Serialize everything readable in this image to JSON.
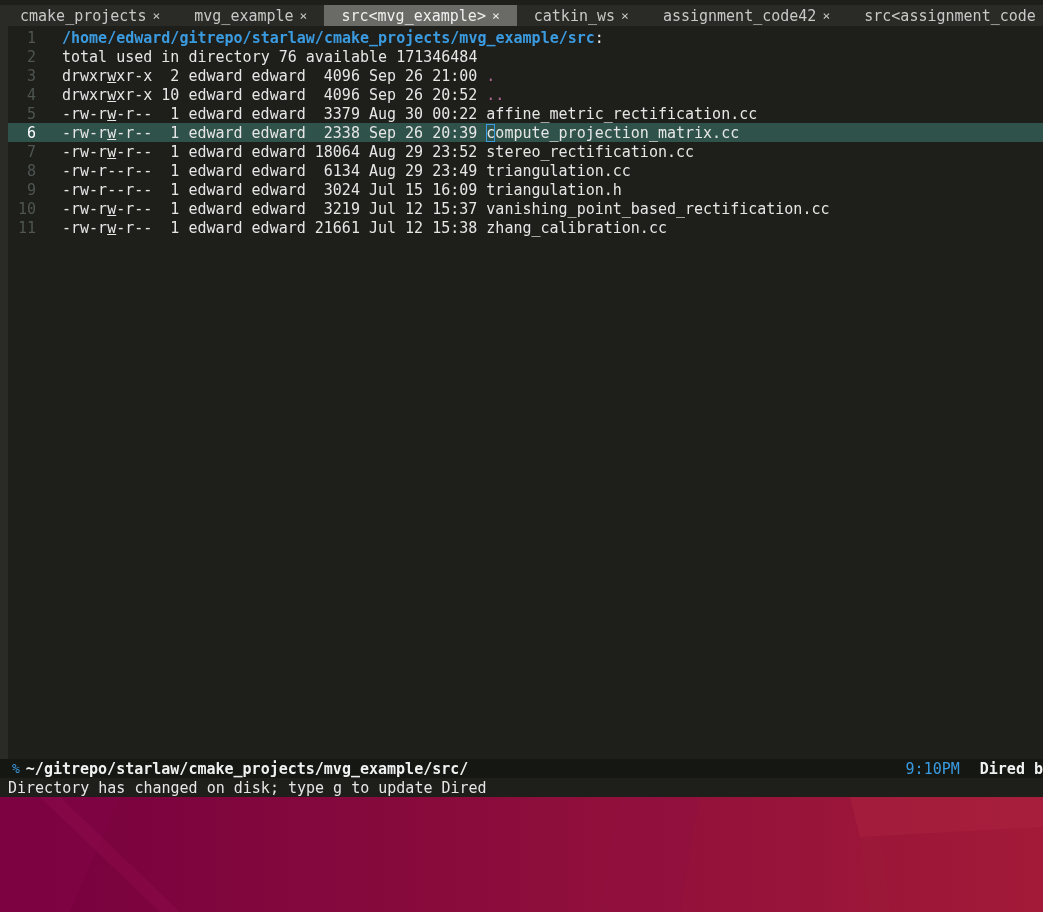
{
  "tabs": [
    {
      "label": "cmake_projects",
      "close": "×",
      "selected": false
    },
    {
      "label": "mvg_example",
      "close": "×",
      "selected": false
    },
    {
      "label": "src<mvg_example>",
      "close": "×",
      "selected": true
    },
    {
      "label": "catkin_ws",
      "close": "×",
      "selected": false
    },
    {
      "label": "assignment_code42",
      "close": "×",
      "selected": false
    },
    {
      "label": "src<assignment_code",
      "selected": false
    }
  ],
  "header": {
    "line": "1",
    "path": "/home/edward/gitrepo/starlaw/cmake_projects/mvg_example/src",
    "suffix": ":"
  },
  "summary": {
    "line": "2",
    "text": "total used in directory 76 available 171346484"
  },
  "rows": [
    {
      "line": "3",
      "perms": "drwxrwxr-x",
      "write_flag": true,
      "links": "2",
      "owner": "edward",
      "group": "edward",
      "size": "4096",
      "date": "Sep 26",
      "time": "21:00",
      "name": ".",
      "kind": "dir",
      "current": false
    },
    {
      "line": "4",
      "perms": "drwxrwxr-x",
      "write_flag": true,
      "links": "10",
      "owner": "edward",
      "group": "edward",
      "size": "4096",
      "date": "Sep 26",
      "time": "20:52",
      "name": "..",
      "kind": "dir",
      "current": false
    },
    {
      "line": "5",
      "perms": "-rw-rw-r--",
      "write_flag": true,
      "links": "1",
      "owner": "edward",
      "group": "edward",
      "size": "3379",
      "date": "Aug 30",
      "time": "00:22",
      "name": "affine_metric_rectification.cc",
      "kind": "file",
      "current": false
    },
    {
      "line": "6",
      "perms": "-rw-rw-r--",
      "write_flag": true,
      "links": "1",
      "owner": "edward",
      "group": "edward",
      "size": "2338",
      "date": "Sep 26",
      "time": "20:39",
      "name": "compute_projection_matrix.cc",
      "kind": "file",
      "current": true
    },
    {
      "line": "7",
      "perms": "-rw-rw-r--",
      "write_flag": true,
      "links": "1",
      "owner": "edward",
      "group": "edward",
      "size": "18064",
      "date": "Aug 29",
      "time": "23:52",
      "name": "stereo_rectification.cc",
      "kind": "file",
      "current": false
    },
    {
      "line": "8",
      "perms": "-rw-r--r--",
      "write_flag": false,
      "links": "1",
      "owner": "edward",
      "group": "edward",
      "size": "6134",
      "date": "Aug 29",
      "time": "23:49",
      "name": "triangulation.cc",
      "kind": "file",
      "current": false
    },
    {
      "line": "9",
      "perms": "-rw-r--r--",
      "write_flag": false,
      "links": "1",
      "owner": "edward",
      "group": "edward",
      "size": "3024",
      "date": "Jul 15",
      "time": "16:09",
      "name": "triangulation.h",
      "kind": "file",
      "current": false
    },
    {
      "line": "10",
      "perms": "-rw-rw-r--",
      "write_flag": true,
      "links": "1",
      "owner": "edward",
      "group": "edward",
      "size": "3219",
      "date": "Jul 12",
      "time": "15:37",
      "name": "vanishing_point_based_rectification.cc",
      "kind": "file",
      "current": false
    },
    {
      "line": "11",
      "perms": "-rw-rw-r--",
      "write_flag": true,
      "links": "1",
      "owner": "edward",
      "group": "edward",
      "size": "21661",
      "date": "Jul 12",
      "time": "15:38",
      "name": "zhang_calibration.cc",
      "kind": "file",
      "current": false
    }
  ],
  "mode_line": {
    "modified": "%",
    "path": "~/gitrepo/starlaw/cmake_projects/mvg_example/src/",
    "time": "9:10PM",
    "mode": "Dired b"
  },
  "echo_area": "Directory has changed on disk; type g to update Dired"
}
